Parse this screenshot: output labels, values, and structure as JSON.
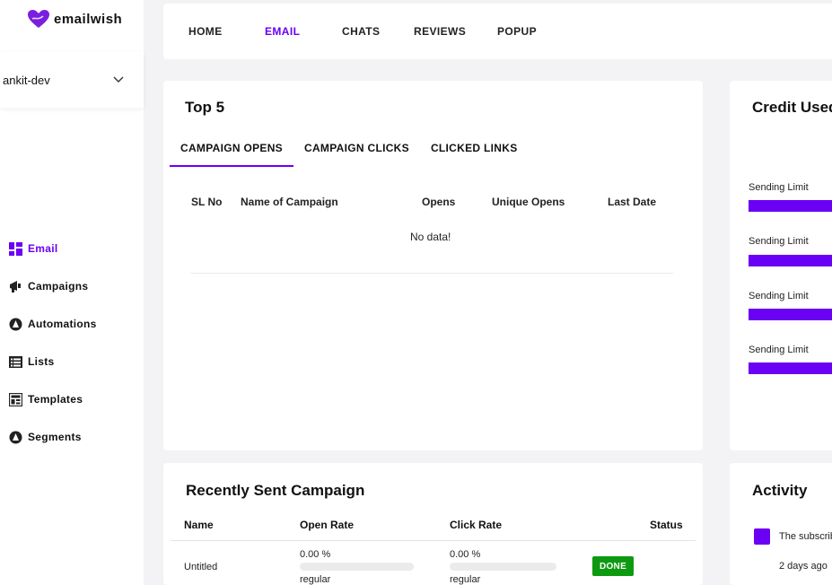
{
  "brand": {
    "name": "emailwish",
    "accent": "#6a00f4"
  },
  "account": {
    "name": "ankit-dev"
  },
  "sidebar": {
    "items": [
      {
        "label": "Email",
        "icon": "dashboard-icon",
        "active": true
      },
      {
        "label": "Campaigns",
        "icon": "megaphone-icon"
      },
      {
        "label": "Automations",
        "icon": "automation-icon"
      },
      {
        "label": "Lists",
        "icon": "list-icon"
      },
      {
        "label": "Templates",
        "icon": "template-icon"
      },
      {
        "label": "Segments",
        "icon": "segment-icon"
      }
    ]
  },
  "topnav": {
    "items": [
      {
        "label": "HOME"
      },
      {
        "label": "EMAIL",
        "active": true
      },
      {
        "label": "CHATS"
      },
      {
        "label": "REVIEWS"
      },
      {
        "label": "POPUP"
      }
    ]
  },
  "top5": {
    "title": "Top 5",
    "tabs": [
      "CAMPAIGN OPENS",
      "CAMPAIGN CLICKS",
      "CLICKED LINKS"
    ],
    "columns": [
      "SL No",
      "Name of Campaign",
      "Opens",
      "Unique Opens",
      "Last Date"
    ],
    "empty_text": "No data!"
  },
  "credit": {
    "title": "Credit Used",
    "limits": [
      "Sending Limit",
      "Sending Limit",
      "Sending Limit",
      "Sending Limit"
    ]
  },
  "recent": {
    "title": "Recently Sent Campaign",
    "columns": [
      "Name",
      "Open Rate",
      "Click Rate",
      "Status"
    ],
    "rows": [
      {
        "name": "Untitled",
        "open_rate": "0.00 %",
        "open_type": "regular",
        "click_rate": "0.00 %",
        "click_type": "regular",
        "status": "DONE"
      }
    ]
  },
  "activity": {
    "title": "Activity",
    "items": [
      {
        "text": "The subscriber",
        "time": "2 days ago"
      }
    ]
  }
}
